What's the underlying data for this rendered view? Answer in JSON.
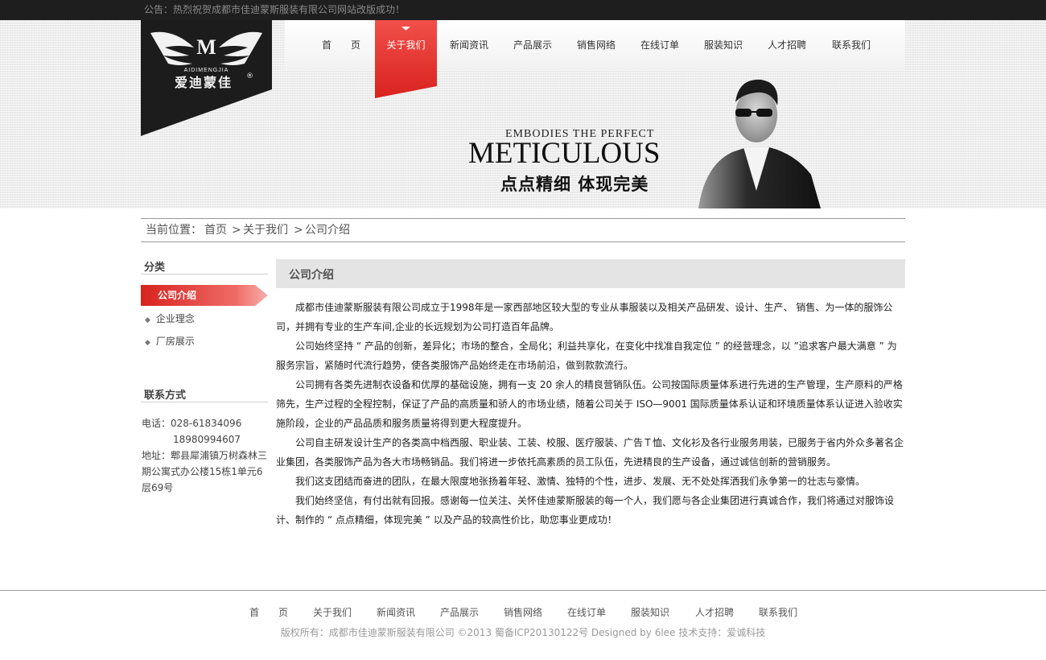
{
  "notice": {
    "text": "公告：热烈祝贺成都市佳迪蒙斯服装有限公司网站改版成功！"
  },
  "logo": {
    "brand_en": "AIDIMENGJIA",
    "brand_cn": "爱迪蒙佳",
    "mark": "M",
    "registered": "®"
  },
  "nav": {
    "items": [
      "首　　页",
      "关于我们",
      "新闻资讯",
      "产品展示",
      "销售网络",
      "在线订单",
      "服装知识",
      "人才招聘",
      "联系我们"
    ],
    "active": "关于我们"
  },
  "banner": {
    "slogan_en_small": "EMBODIES THE PERFECT",
    "slogan_en_big": "METICULOUS",
    "slogan_cn": "点点精细  体现完美"
  },
  "breadcrumb": {
    "prefix": "当前位置：",
    "items": [
      "首页",
      "关于我们",
      "公司介绍"
    ],
    "separator": ">"
  },
  "sidebar": {
    "category_title": "分类",
    "items": [
      {
        "label": "公司介绍",
        "active": true
      },
      {
        "label": "企业理念",
        "active": false
      },
      {
        "label": "厂房展示",
        "active": false
      }
    ],
    "contact_title": "联系方式",
    "contact": {
      "phone_label": "电话：",
      "phone1": "028-61834096",
      "phone2": "18980994607",
      "address_label": "地址：",
      "address_line1": "郫县犀浦镇万树森林三",
      "address_line2": "期公寓式办公楼15栋1单元6",
      "address_line3": "层69号"
    }
  },
  "main": {
    "title": "公司介绍",
    "paragraphs": [
      "成都市佳迪蒙斯服装有限公司成立于1998年是一家西部地区较大型的专业从事服装以及相关产品研发、设计、生产、 销售、为一体的服饰公司，并拥有专业的生产车间,企业的长远规划为公司打造百年品牌。",
      "公司始终坚持 “ 产品的创新，差异化；市场的整合，全局化；利益共享化，在变化中找准自我定位 ” 的经营理念，以 ”追求客户最大满意 ” 为服务宗旨，紧随时代流行趋势，使各类服饰产品始终走在市场前沿，做到款款流行。",
      "公司拥有各类先进制衣设备和优厚的基础设施，拥有一支 20 余人的精良营销队伍。公司按国际质量体系进行先进的生产管理，生产原料的严格筛先，生产过程的全程控制，保证了产品的高质量和骄人的市场业绩，随着公司关于 ISO—9001 国际质量体系认证和环境质量体系认证进入验收实施阶段，企业的产品品质和服务质量将得到更大程度提升。",
      "公司自主研发设计生产的各类高中档西服、职业装、工装、校服、医疗服装、广告Ｔ恤、文化衫及各行业服务用装，已服务于省内外众多著名企业集团，各类服饰产品为各大市场畅销品。我们将进一步依托高素质的员工队伍，先进精良的生产设备，通过诚信创新的营销服务。",
      "我们这支团结而奋进的团队，在最大限度地张扬着年轻、激情、独特的个性，进步、发展、无不处处挥洒我们永争第一的壮志与豪情。",
      "我们始终坚信，有付出就有回报。感谢每一位关注、关怀佳迪蒙斯服装的每一个人，我们愿与各企业集团进行真诚合作，我们将通过对服饰设计、制作的 “ 点点精细，体现完美 ” 以及产品的较高性价比，助您事业更成功！"
    ]
  },
  "footer": {
    "nav": [
      "首　　页",
      "关于我们",
      "新闻资讯",
      "产品展示",
      "销售网络",
      "在线订单",
      "服装知识",
      "人才招聘",
      "联系我们"
    ],
    "copyright": "版权所有：成都市佳迪蒙斯服装有限公司 ©2013 蜀备ICP20130122号   Designed by 6lee 技术支持：爱诚科技"
  },
  "colors": {
    "accent_red": "#e8322e",
    "dark": "#1e1e1e",
    "gray_bg": "#ededed"
  }
}
